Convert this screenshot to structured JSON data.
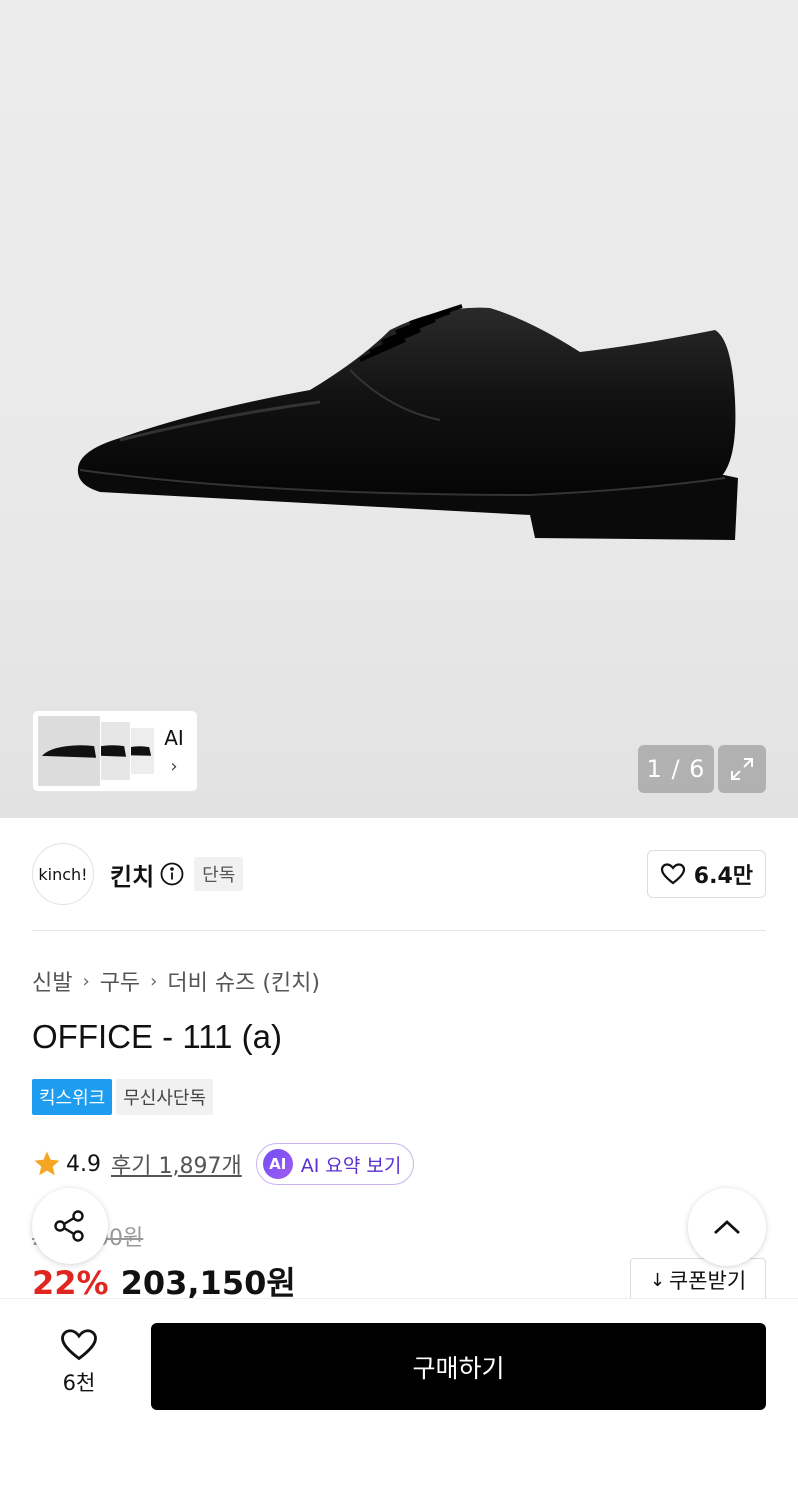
{
  "gallery": {
    "thumb_ai_label": "AI",
    "thumb_chevron": "›",
    "counter": "1 / 6",
    "expand_icon": "expand-icon"
  },
  "brand": {
    "logo_text": "kinch!",
    "name": "킨치",
    "exclusive_tag": "단독",
    "like_count": "6.4만"
  },
  "breadcrumb": {
    "items": [
      "신발",
      "구두",
      "더비 슈즈 (킨치)"
    ],
    "separator": "›"
  },
  "product": {
    "title": "OFFICE - 111 (a)",
    "badges": [
      "킥스위크",
      "무신사단독"
    ],
    "rating": "4.9",
    "review_link": "후기 1,897개",
    "ai_summary_badge": "AI",
    "ai_summary_label": "AI 요약 보기",
    "original_price": "260,500원",
    "discount": "22%",
    "price": "203,150원",
    "coupon_label": "쿠폰받기",
    "coupon_icon": "↓"
  },
  "bottom_bar": {
    "like_count": "6천",
    "buy_label": "구매하기"
  },
  "colors": {
    "discount": "#e0271f",
    "badge_blue": "#1e9cf0",
    "ai_purple": "#5b2fd3",
    "buy_button": "#000000",
    "star": "#f5a623"
  }
}
